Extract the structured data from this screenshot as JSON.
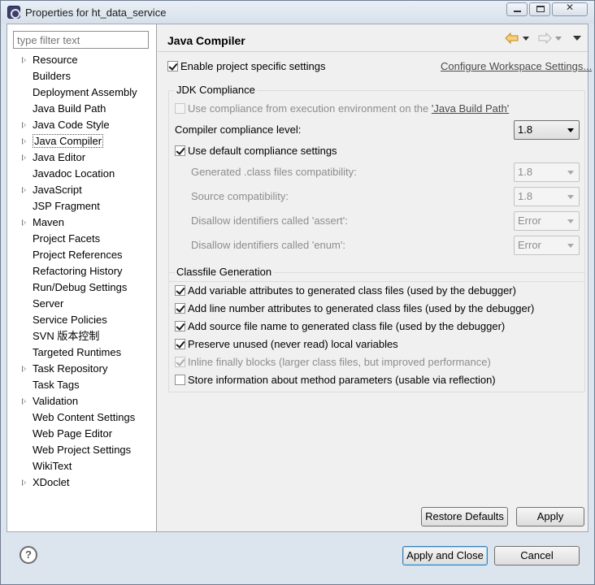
{
  "window": {
    "title": "Properties for ht_data_service"
  },
  "filter": {
    "placeholder": "type filter text"
  },
  "tree": {
    "items": [
      {
        "label": "Resource",
        "expandable": true
      },
      {
        "label": "Builders",
        "expandable": false
      },
      {
        "label": "Deployment Assembly",
        "expandable": false
      },
      {
        "label": "Java Build Path",
        "expandable": false
      },
      {
        "label": "Java Code Style",
        "expandable": true
      },
      {
        "label": "Java Compiler",
        "expandable": true,
        "selected": true
      },
      {
        "label": "Java Editor",
        "expandable": true
      },
      {
        "label": "Javadoc Location",
        "expandable": false
      },
      {
        "label": "JavaScript",
        "expandable": true
      },
      {
        "label": "JSP Fragment",
        "expandable": false
      },
      {
        "label": "Maven",
        "expandable": true
      },
      {
        "label": "Project Facets",
        "expandable": false
      },
      {
        "label": "Project References",
        "expandable": false
      },
      {
        "label": "Refactoring History",
        "expandable": false
      },
      {
        "label": "Run/Debug Settings",
        "expandable": false
      },
      {
        "label": "Server",
        "expandable": false
      },
      {
        "label": "Service Policies",
        "expandable": false
      },
      {
        "label": "SVN 版本控制",
        "expandable": false
      },
      {
        "label": "Targeted Runtimes",
        "expandable": false
      },
      {
        "label": "Task Repository",
        "expandable": true
      },
      {
        "label": "Task Tags",
        "expandable": false
      },
      {
        "label": "Validation",
        "expandable": true
      },
      {
        "label": "Web Content Settings",
        "expandable": false
      },
      {
        "label": "Web Page Editor",
        "expandable": false
      },
      {
        "label": "Web Project Settings",
        "expandable": false
      },
      {
        "label": "WikiText",
        "expandable": false
      },
      {
        "label": "XDoclet",
        "expandable": true
      }
    ]
  },
  "page": {
    "title": "Java Compiler",
    "enable_specific": {
      "label": "Enable project specific settings",
      "checked": true
    },
    "configure_link": "Configure Workspace Settings...",
    "jdk": {
      "title": "JDK Compliance",
      "use_compliance_prefix": "Use compliance from execution environment on the ",
      "use_compliance_link": "'Java Build Path'",
      "compliance_level_label": "Compiler compliance level:",
      "compliance_level_value": "1.8",
      "use_default_label": "Use default compliance settings",
      "generated_label": "Generated .class files compatibility:",
      "generated_value": "1.8",
      "source_label": "Source compatibility:",
      "source_value": "1.8",
      "assert_label": "Disallow identifiers called 'assert':",
      "assert_value": "Error",
      "enum_label": "Disallow identifiers called 'enum':",
      "enum_value": "Error"
    },
    "classfile": {
      "title": "Classfile Generation",
      "options": [
        {
          "label": "Add variable attributes to generated class files (used by the debugger)",
          "checked": true,
          "disabled": false
        },
        {
          "label": "Add line number attributes to generated class files (used by the debugger)",
          "checked": true,
          "disabled": false
        },
        {
          "label": "Add source file name to generated class file (used by the debugger)",
          "checked": true,
          "disabled": false
        },
        {
          "label": "Preserve unused (never read) local variables",
          "checked": true,
          "disabled": false
        },
        {
          "label": "Inline finally blocks (larger class files, but improved performance)",
          "checked": true,
          "disabled": true
        },
        {
          "label": "Store information about method parameters (usable via reflection)",
          "checked": false,
          "disabled": false
        }
      ]
    },
    "restore_defaults": "Restore Defaults",
    "apply": "Apply"
  },
  "footer": {
    "help": "?",
    "apply_close": "Apply and Close",
    "cancel": "Cancel"
  },
  "icons": {
    "back": "back-arrow-icon",
    "forward": "forward-arrow-icon",
    "menu": "view-menu-icon"
  }
}
